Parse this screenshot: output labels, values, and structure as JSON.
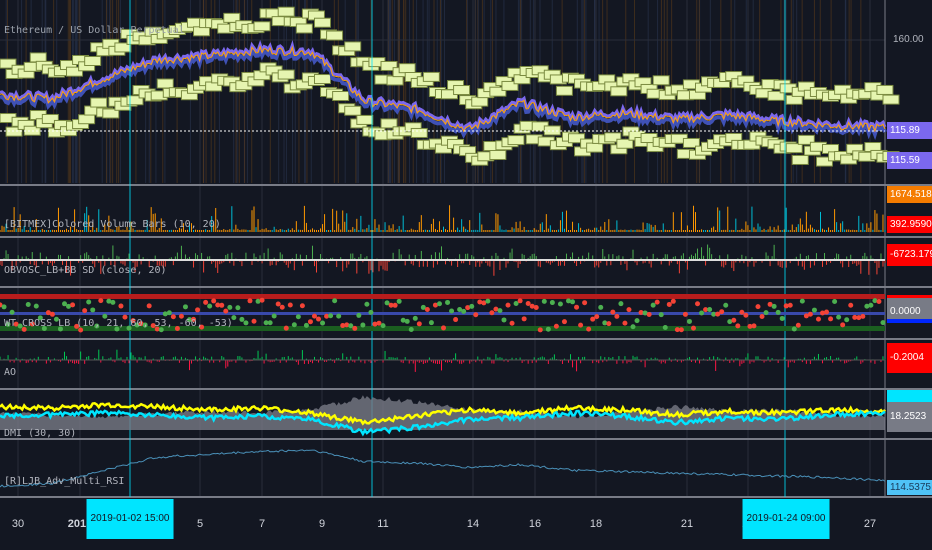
{
  "symbol_title": "Ethereum / US Dollar Perpetual",
  "colors": {
    "background": "#131722",
    "separator": "#787b86",
    "crosshair": "#00e5ff",
    "price_label": "#7b68ee",
    "volume_label": "#f57c00",
    "red": "#ff0000",
    "cyan": "#00e5ff",
    "yellow": "#ffff00",
    "rsi": "#4fc3f7"
  },
  "chart_data": [
    {
      "type": "line",
      "pane": "price",
      "title": "Ethereum / US Dollar Perpetual",
      "x": [
        "30",
        "2019",
        "5",
        "7",
        "9",
        "11",
        "14",
        "16",
        "18",
        "21",
        "23",
        "27"
      ],
      "ylim": [
        90,
        180
      ],
      "y_ticks": [
        "160.00"
      ],
      "series": [
        {
          "values": [
            133,
            131,
            141,
            150,
            152,
            155,
            154,
            130,
            126,
            116,
            129,
            122,
            124,
            121,
            123,
            120,
            118,
            117
          ]
        }
      ],
      "price_labels": [
        "115.89",
        "115.59"
      ]
    },
    {
      "type": "bar",
      "pane": "volume",
      "title": "[BITMEX]Colored Volume Bars (10, 20)",
      "labels": [
        "1674.5186",
        "392.9590"
      ]
    },
    {
      "type": "area",
      "pane": "obv",
      "title": "OBVOSC_LB+BB SD (close, 20)",
      "labels": [
        "-6723.1794"
      ]
    },
    {
      "type": "scatter",
      "pane": "wavetrend",
      "title": "WT CROSS LB (10, 21, 60, 53, -60, -53)",
      "labels": [
        "0.0000"
      ]
    },
    {
      "type": "bar",
      "pane": "ao",
      "title": "AO",
      "labels": [
        "-0.2004"
      ]
    },
    {
      "type": "line",
      "pane": "dmi",
      "title": "DMI (30, 30)",
      "labels": [
        "18.2523"
      ],
      "series": [
        {
          "name": "+DI",
          "values": [
            24,
            23,
            25,
            24,
            22,
            23,
            20,
            14,
            18,
            22,
            20,
            23,
            22,
            19,
            21,
            20,
            22,
            21
          ]
        },
        {
          "name": "-DI",
          "values": [
            20,
            19,
            18,
            19,
            21,
            20,
            22,
            30,
            27,
            22,
            21,
            18,
            20,
            24,
            21,
            22,
            19,
            18
          ]
        }
      ]
    },
    {
      "type": "line",
      "pane": "rsi",
      "title": "[R]LJB_Adv_Multi_RSI",
      "labels": [
        "114.5375"
      ],
      "series": [
        {
          "values": [
            111,
            113,
            122,
            131,
            133,
            135,
            136,
            128,
            127,
            124,
            126,
            122,
            121,
            120,
            119,
            118,
            117,
            115
          ]
        }
      ]
    }
  ],
  "time_axis": {
    "ticks": [
      "30",
      "2019",
      "5",
      "7",
      "9",
      "11",
      "14",
      "16",
      "18",
      "21",
      "23",
      "27"
    ],
    "highlighted": [
      "2019-01-02  15:00",
      "2019-01-24  09:00"
    ]
  }
}
